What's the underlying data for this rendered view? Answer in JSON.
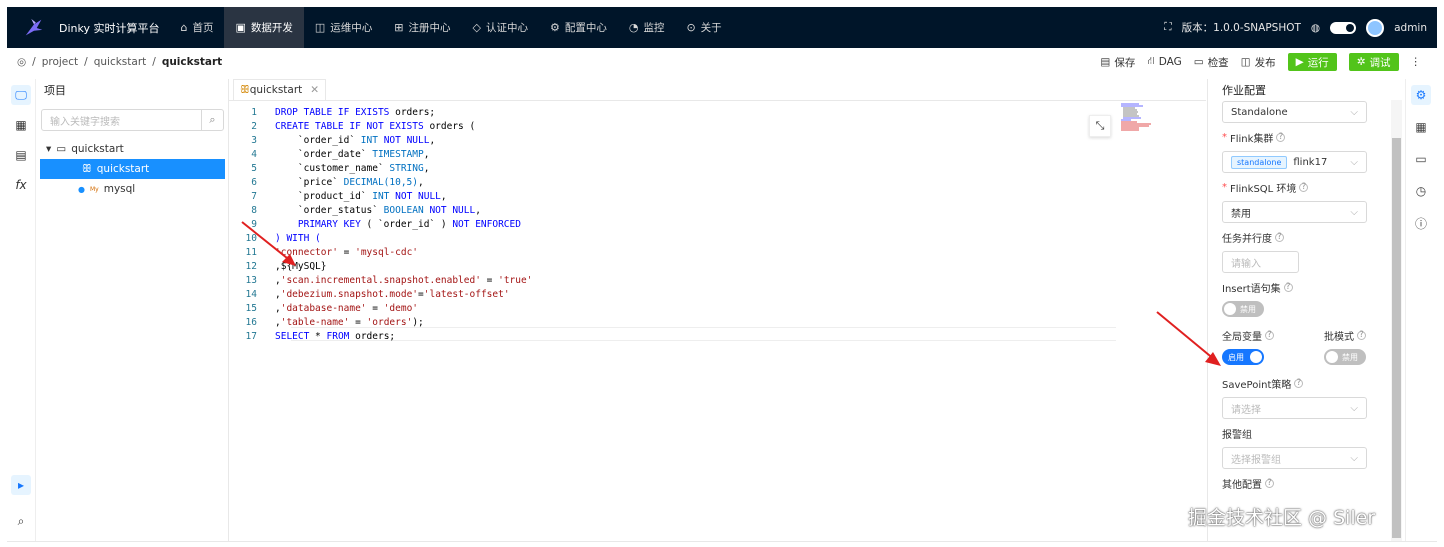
{
  "header": {
    "brand": "Dinky 实时计算平台",
    "nav": [
      {
        "icon": "⌂",
        "label": "首页"
      },
      {
        "icon": "▣",
        "label": "数据开发"
      },
      {
        "icon": "◫",
        "label": "运维中心"
      },
      {
        "icon": "⊞",
        "label": "注册中心"
      },
      {
        "icon": "◇",
        "label": "认证中心"
      },
      {
        "icon": "⚙",
        "label": "配置中心"
      },
      {
        "icon": "◔",
        "label": "监控"
      },
      {
        "icon": "⊙",
        "label": "关于"
      }
    ],
    "version": "版本：1.0.0-SNAPSHOT",
    "user": "admin"
  },
  "breadcrumb": {
    "sep": "/",
    "items": [
      "project",
      "quickstart",
      "quickstart"
    ]
  },
  "toolbar": {
    "save": "保存",
    "dag": "DAG",
    "check": "检查",
    "publish": "发布",
    "run": "运行",
    "debug": "调试"
  },
  "project": {
    "title": "项目",
    "search_placeholder": "输入关键字搜索",
    "tree": {
      "folder": "quickstart",
      "job": "quickstart",
      "datasource_prefix": "My",
      "datasource": "mysql"
    }
  },
  "editor": {
    "tab": "quickstart",
    "lines": [
      [
        {
          "t": "DROP TABLE IF EXISTS",
          "c": "kw"
        },
        {
          "t": " orders;",
          "c": "txt"
        }
      ],
      [
        {
          "t": "CREATE TABLE IF NOT EXISTS",
          "c": "kw"
        },
        {
          "t": " orders (",
          "c": "txt"
        }
      ],
      [
        {
          "t": "    `order_id` ",
          "c": "txt"
        },
        {
          "t": "INT",
          "c": "ty"
        },
        {
          "t": " NOT NULL",
          "c": "kw"
        },
        {
          "t": ",",
          "c": "txt"
        }
      ],
      [
        {
          "t": "    `order_date` ",
          "c": "txt"
        },
        {
          "t": "TIMESTAMP",
          "c": "ty"
        },
        {
          "t": ",",
          "c": "txt"
        }
      ],
      [
        {
          "t": "    `customer_name` ",
          "c": "txt"
        },
        {
          "t": "STRING",
          "c": "ty"
        },
        {
          "t": ",",
          "c": "txt"
        }
      ],
      [
        {
          "t": "    `price` ",
          "c": "txt"
        },
        {
          "t": "DECIMAL(10,5)",
          "c": "ty"
        },
        {
          "t": ",",
          "c": "txt"
        }
      ],
      [
        {
          "t": "    `product_id` ",
          "c": "txt"
        },
        {
          "t": "INT",
          "c": "ty"
        },
        {
          "t": " NOT NULL",
          "c": "kw"
        },
        {
          "t": ",",
          "c": "txt"
        }
      ],
      [
        {
          "t": "    `order_status` ",
          "c": "txt"
        },
        {
          "t": "BOOLEAN",
          "c": "ty"
        },
        {
          "t": " NOT NULL",
          "c": "kw"
        },
        {
          "t": ",",
          "c": "txt"
        }
      ],
      [
        {
          "t": "    PRIMARY KEY",
          "c": "kw"
        },
        {
          "t": " ( `order_id` ) ",
          "c": "txt"
        },
        {
          "t": "NOT ENFORCED",
          "c": "kw"
        }
      ],
      [
        {
          "t": ") WITH (",
          "c": "kw"
        }
      ],
      [
        {
          "t": "'connector'",
          "c": "str"
        },
        {
          "t": " = ",
          "c": "txt"
        },
        {
          "t": "'mysql-cdc'",
          "c": "str"
        }
      ],
      [
        {
          "t": ",${MySQL}",
          "c": "txt"
        }
      ],
      [
        {
          "t": ",",
          "c": "txt"
        },
        {
          "t": "'scan.incremental.snapshot.enabled'",
          "c": "str"
        },
        {
          "t": " = ",
          "c": "txt"
        },
        {
          "t": "'true'",
          "c": "str"
        }
      ],
      [
        {
          "t": ",",
          "c": "txt"
        },
        {
          "t": "'debezium.snapshot.mode'",
          "c": "str"
        },
        {
          "t": "=",
          "c": "txt"
        },
        {
          "t": "'latest-offset'",
          "c": "str"
        }
      ],
      [
        {
          "t": ",",
          "c": "txt"
        },
        {
          "t": "'database-name'",
          "c": "str"
        },
        {
          "t": " = ",
          "c": "txt"
        },
        {
          "t": "'demo'",
          "c": "str"
        }
      ],
      [
        {
          "t": ",",
          "c": "txt"
        },
        {
          "t": "'table-name'",
          "c": "str"
        },
        {
          "t": " = ",
          "c": "txt"
        },
        {
          "t": "'orders'",
          "c": "str"
        },
        {
          "t": ");",
          "c": "txt"
        }
      ],
      [
        {
          "t": "SELECT",
          "c": "kw"
        },
        {
          "t": " * ",
          "c": "txt"
        },
        {
          "t": "FROM",
          "c": "kw"
        },
        {
          "t": " orders;",
          "c": "txt"
        }
      ]
    ]
  },
  "config": {
    "title": "作业配置",
    "mode": "Standalone",
    "cluster_label": "Flink集群",
    "cluster_tag": "standalone",
    "cluster_value": "flink17",
    "env_label": "FlinkSQL 环境",
    "env_value": "禁用",
    "parallel_label": "任务并行度",
    "parallel_placeholder": "请输入",
    "insert_label": "Insert语句集",
    "insert_state": "禁用",
    "global_label": "全局变量",
    "global_state": "启用",
    "batch_label": "批模式",
    "batch_state": "禁用",
    "savepoint_label": "SavePoint策略",
    "savepoint_placeholder": "请选择",
    "alert_label": "报警组",
    "alert_placeholder": "选择报警组",
    "other_label": "其他配置"
  },
  "watermark": "掘金技术社区 @ Siler",
  "colors": {
    "header_bg": "#001529",
    "accent": "#1677ff",
    "green": "#52c41a",
    "arrow": "#e02020"
  }
}
